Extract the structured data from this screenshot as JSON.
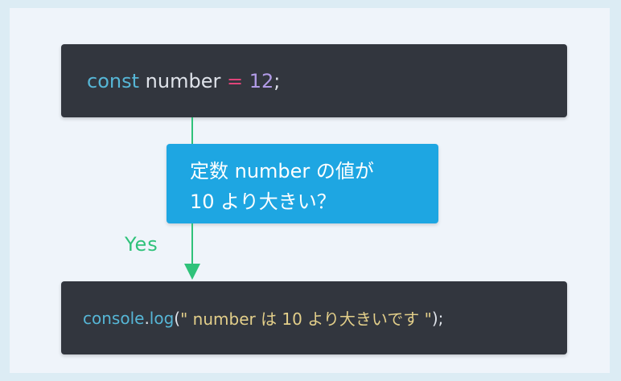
{
  "colors": {
    "background": "#eff4fa",
    "code_box": "#32363e",
    "decision_box": "#1ea6e2",
    "arrow": "#2fc27a",
    "keyword": "#56b6d6",
    "identifier": "#dfe3ea",
    "operator": "#e0457a",
    "number": "#b19be6",
    "string": "#e3cf8a"
  },
  "code_top": {
    "keyword": "const",
    "name": "number",
    "operator": "=",
    "value": "12",
    "end": ";"
  },
  "decision": {
    "line1": "定数 number の値が",
    "line2": "10 より大きい？"
  },
  "yes_label": "Yes",
  "code_bottom": {
    "object": "console",
    "dot": ".",
    "method": "log",
    "open": "(",
    "string": "\" number は 10 より大きいです \"",
    "close": ");"
  }
}
